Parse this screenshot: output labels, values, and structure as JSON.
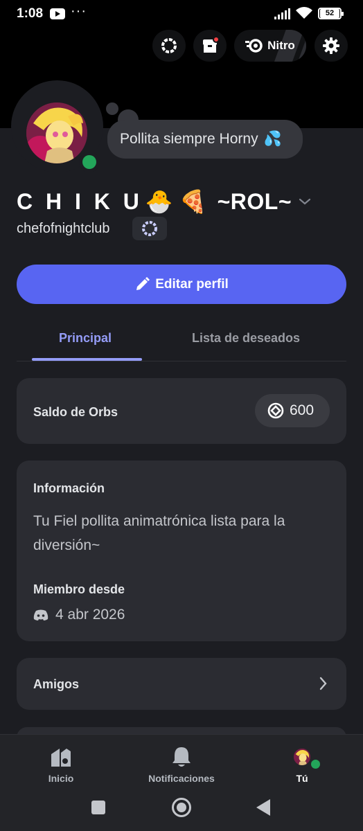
{
  "status_bar": {
    "time": "1:08",
    "dots": "···",
    "battery": "52"
  },
  "top_actions": {
    "nitro_label": "Nitro"
  },
  "profile": {
    "custom_status": "Pollita siempre Horny",
    "status_emoji": "💦",
    "display_name": "C H I K U",
    "display_name_emojis": [
      "🐣",
      "🍕"
    ],
    "display_name_suffix": "~ROL~",
    "username": "chefofnightclub"
  },
  "edit_button": {
    "label": "Editar perfil"
  },
  "tabs": [
    {
      "label": "Principal",
      "active": true
    },
    {
      "label": "Lista de deseados",
      "active": false
    }
  ],
  "orbs": {
    "label": "Saldo de Orbs",
    "value": "600"
  },
  "info": {
    "title": "Información",
    "bio": "Tu Fiel pollita animatrónica lista para la diversión~",
    "member_since_title": "Miembro desde",
    "member_since_date": "4 abr 2026"
  },
  "friends": {
    "label": "Amigos"
  },
  "bottom_nav": [
    {
      "label": "Inicio",
      "icon": "home-icon",
      "active": false
    },
    {
      "label": "Notificaciones",
      "icon": "bell-icon",
      "active": false
    },
    {
      "label": "Tú",
      "icon": "avatar",
      "active": true
    }
  ],
  "colors": {
    "accent": "#5865f2",
    "tab_active": "#949cf7",
    "online": "#23a55a",
    "background": "#1c1d22",
    "card": "#2b2c32"
  }
}
